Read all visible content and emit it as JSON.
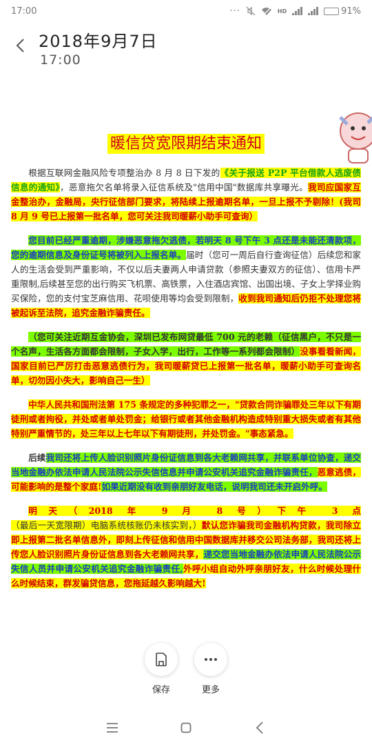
{
  "status_bar": {
    "time": "17:00",
    "dots": "···",
    "net_label": "HD",
    "battery": "91%",
    "battery_level": 0.91
  },
  "header": {
    "back_icon": "chevron-left-icon",
    "date": "2018年9月7日",
    "time": "17:00"
  },
  "document": {
    "title": "暖信贷宽限期结束通知",
    "p1": [
      "根据互联网金融风险专项整治办 8 月 8 日下发的",
      "《关于报送 P2P 平台借款人逃废债信息的通知》",
      "，恶意拖欠名单将录入征信系统及\"信用中国\"数据库共享曝光。",
      "我司应国家互金整治办，金融局，央行征信部门要求，将陆续上报逾期名单，一旦上报不予剔除！(我司 8 月 9 号已上报第一批名单，您可关注我司暖薪小助手可查询）"
    ],
    "p2": [
      "您目前已经严重逾期，涉嫌恶意拖欠逃债，若明天 8 号下午 3 点还是未能还清款项，您的逾期信息及身份证号将被列入上报名单。",
      "届时（您可一周后自行查询征信）后续您和家人的生活会受到严重影响，不仅以后夫妻两人申请贷款（参照夫妻双方的征信）、信用卡严重限制,后续甚至您的出行购买飞机票、高铁票，入住酒店宾馆、出国出境、子女上学择业购买保险，您的支付宝芝麻信用、花呗使用等均会受到限制，",
      "收到我司通知后仍拒不处理您将被起诉至法院，追究金融诈骗责任。"
    ],
    "p3": [
      "（您可关注近期互金协会，深圳已发布网贷最低 700 元的老赖（征信黑户，不只是一个名声，生活各方面都会限制，子女入学，出行，工作等一系列都会限制）",
      "没事看看新闻，国家目前已严厉打击恶意逃债行为，我司暖薪贷已上报第一批名单，暖薪小助手可查询名单，切勿因小失大，影响自己一生）"
    ],
    "p4": [
      "中华人民共和国刑法第 175 条规定的多种犯罪之一，",
      "\"贷款合同诈骗罪处三年以下有期徒刑或者拘役，并处或者单处罚金；给银行或者其他金融机构造成特别重大损失或者有其他特别严重情节的，处三年以上七年以下有期徒刑，并处罚金。\"事态紧急。"
    ],
    "p5": [
      "后续",
      "我司还将上传人脸识别照片身份证信息到各大老赖网共享，并联系单位协查，递交当地金融办依法申请人民法院公示失信信息并申请公安机关追究金融诈骗责任，",
      "恶意逃债，可能影响的是整个家庭!",
      "如果近期没有收到亲朋好友电话，说明我司还未开启外呼。"
    ],
    "p6": [
      "明天（2018 年 9 月 8 号）下午 3 点",
      "（最后一天宽限期）电脑系统核账仍未核实到，）",
      "默认您诈骗我司金融机构贷款，我司除立即上报第二批名单信息外，即刻上传征信和信用中国数据库并移交公司法务部，我司还将上传您人脸识别照片身份证信息到各大老赖网共享，",
      "递交您当地金融办依法申请人民法院公示失信人员并申请公安机关追究金融诈骗责任,",
      "外呼小组自动外呼亲朋好友，什么时候处理什么时候结束，群发骗贷信息，您拖延越久影响越大!"
    ]
  },
  "actions": {
    "save_label": "保存",
    "more_label": "更多",
    "save_icon": "save-icon",
    "more_icon": "more-dots-icon"
  },
  "nav": {
    "menu_icon": "menu-icon",
    "home_icon": "home-icon",
    "back_icon": "back-icon"
  }
}
